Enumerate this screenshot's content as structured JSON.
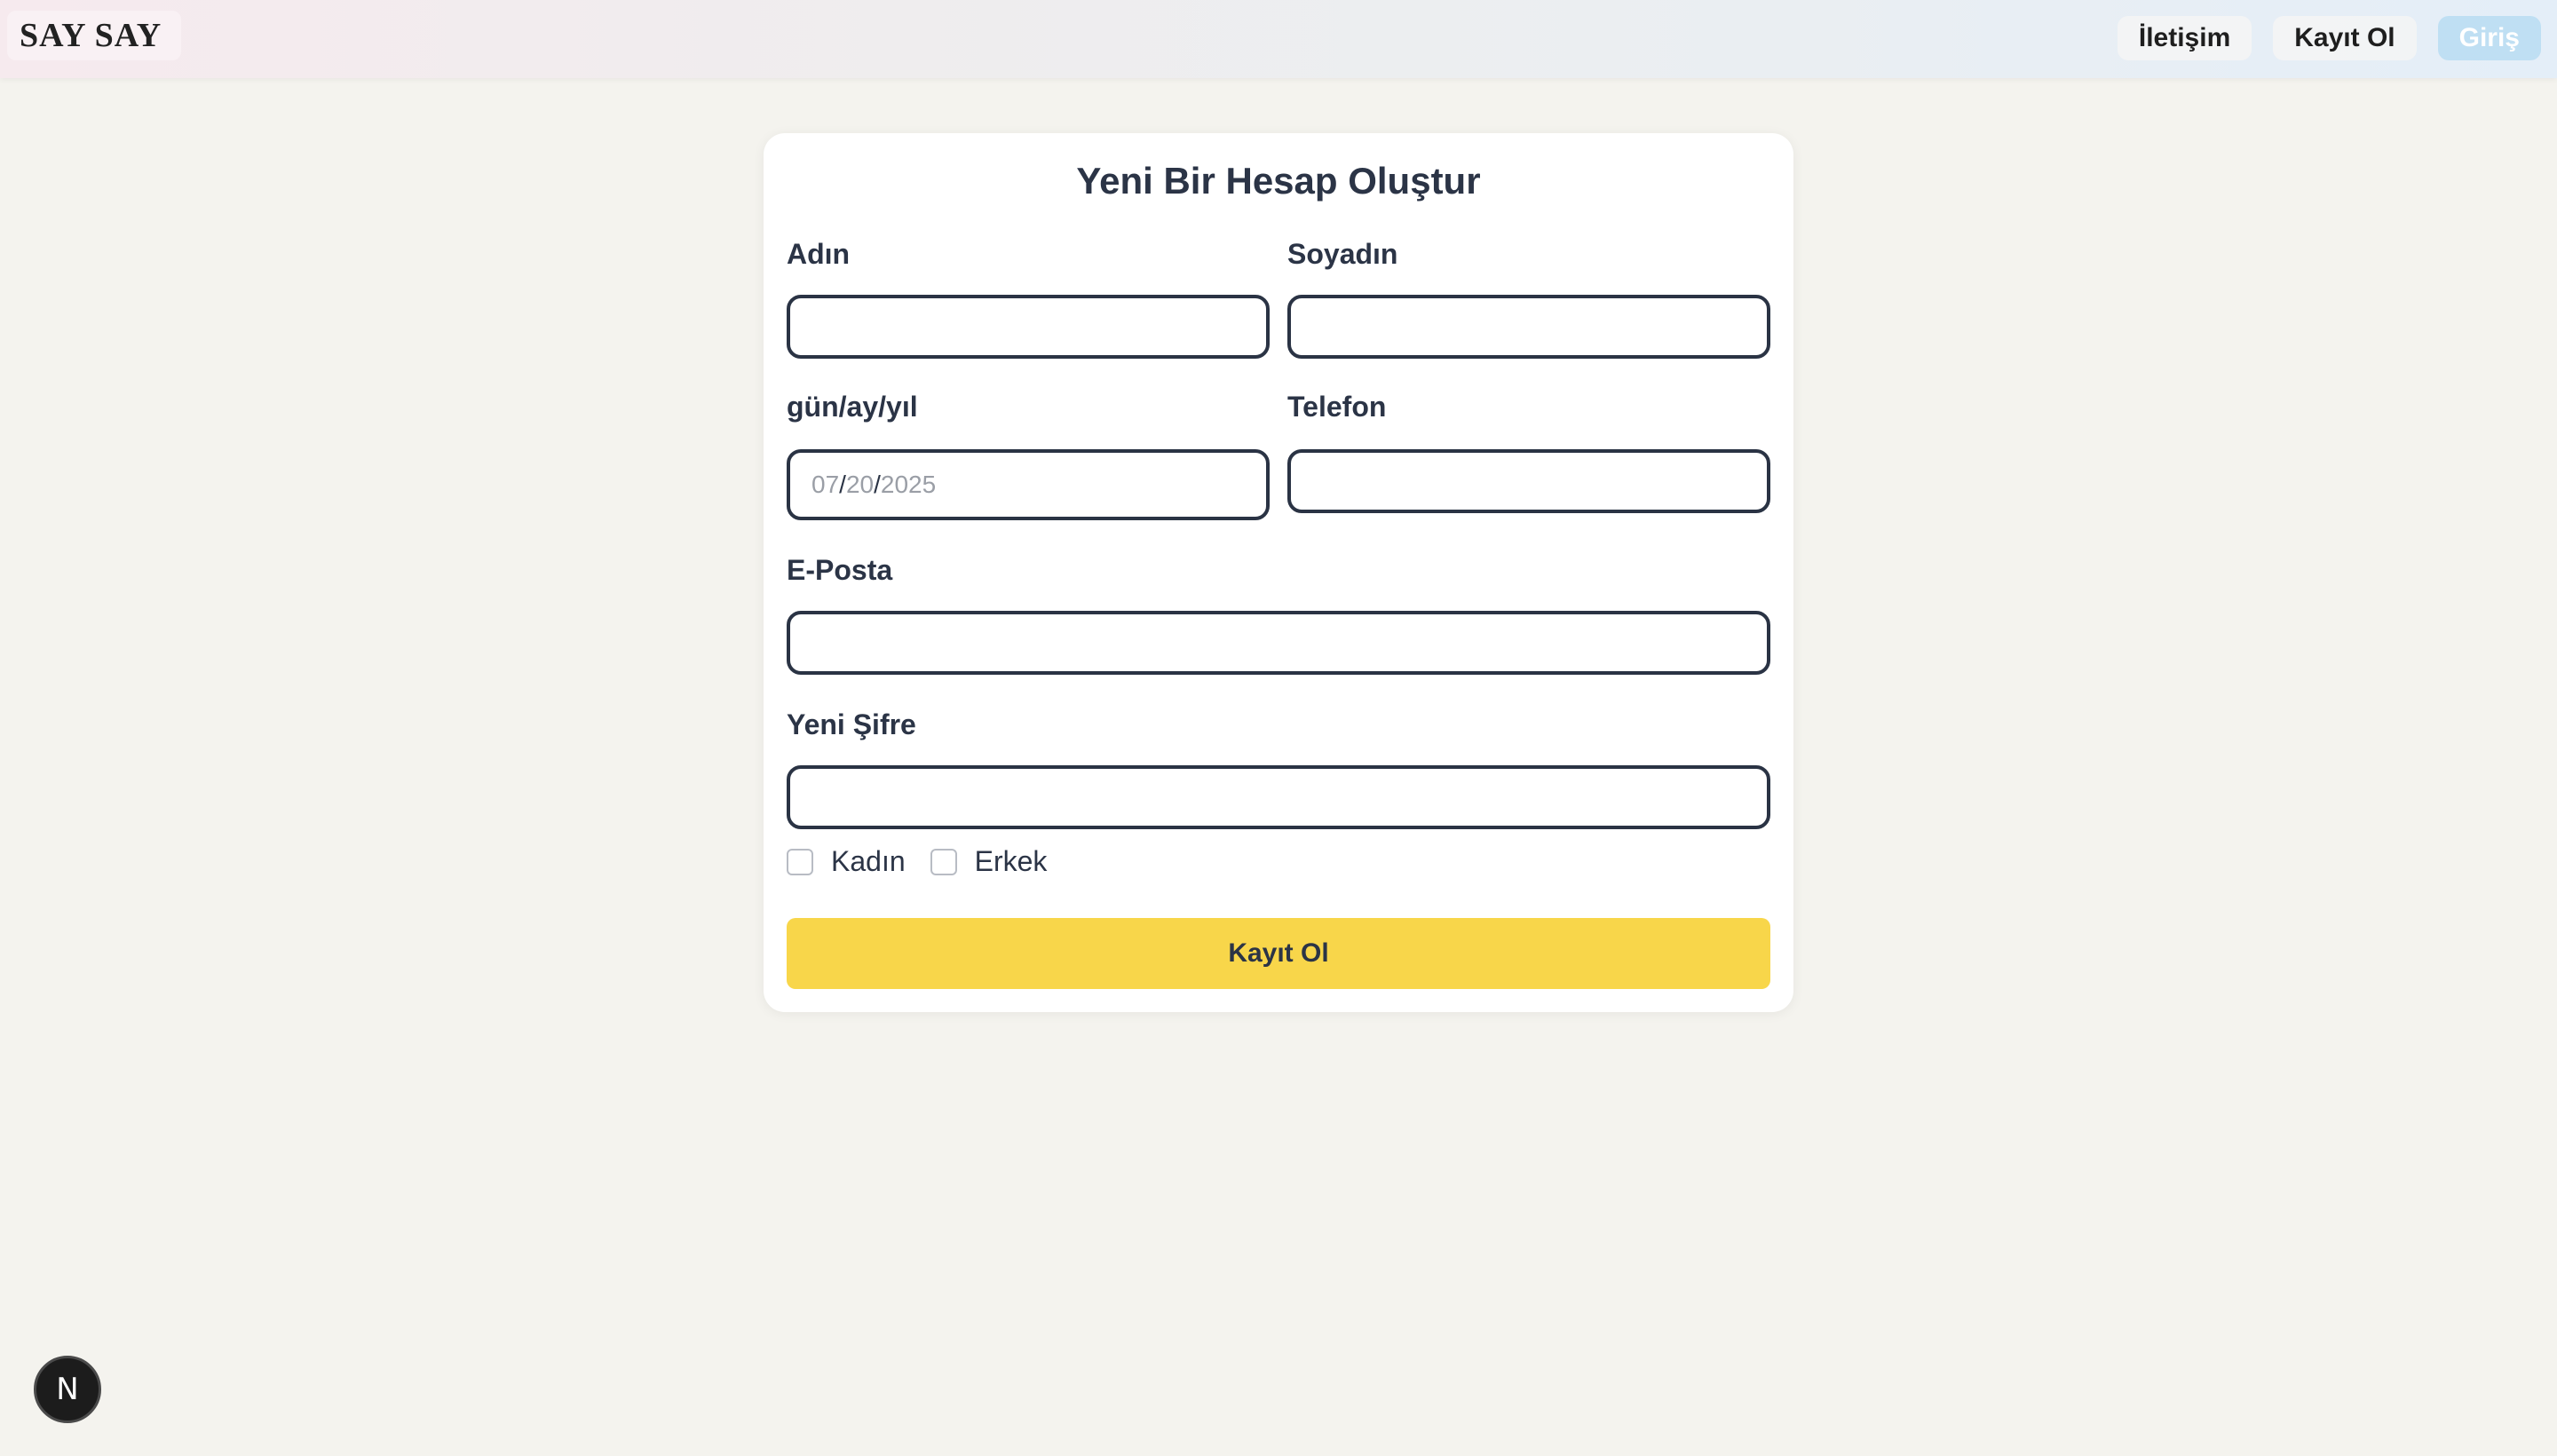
{
  "header": {
    "logo": "SAY SAY",
    "nav": {
      "contact": "İletişim",
      "register": "Kayıt Ol",
      "login": "Giriş"
    }
  },
  "form": {
    "title": "Yeni Bir Hesap Oluştur",
    "first_name": {
      "label": "Adın",
      "value": ""
    },
    "last_name": {
      "label": "Soyadın",
      "value": ""
    },
    "birthdate": {
      "label": "gün/ay/yıl",
      "month": "07",
      "day": "20",
      "year": "2025",
      "sep": "/"
    },
    "phone": {
      "label": "Telefon",
      "value": ""
    },
    "email": {
      "label": "E-Posta",
      "value": ""
    },
    "password": {
      "label": "Yeni Şifre",
      "value": ""
    },
    "gender": {
      "female": "Kadın",
      "male": "Erkek"
    },
    "submit_label": "Kayıt Ol"
  },
  "dev_badge": {
    "letter": "N"
  },
  "colors": {
    "background": "#f4f3ee",
    "card": "#ffffff",
    "input_border": "#2a3344",
    "submit": "#f8d64a",
    "login_button": "#bfdff3"
  },
  "icons": {
    "dev_badge": "nextjs-logo-icon"
  }
}
